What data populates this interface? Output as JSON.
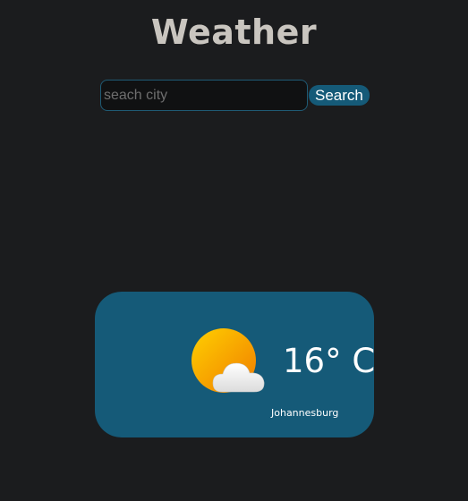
{
  "header": {
    "title": "Weather"
  },
  "search": {
    "placeholder": "seach city",
    "value": "",
    "button_label": "Search"
  },
  "weather": {
    "icon": "partly-cloudy-sun-icon",
    "temperature": "16° C",
    "city": "Johannesburg"
  },
  "colors": {
    "background": "#1b1c1e",
    "accent": "#155a78",
    "title": "#c9c5bf",
    "input_background": "#101112",
    "sun_orange": "#f59a00",
    "sun_yellow": "#ffd000",
    "cloud": "#f3f3f3"
  }
}
